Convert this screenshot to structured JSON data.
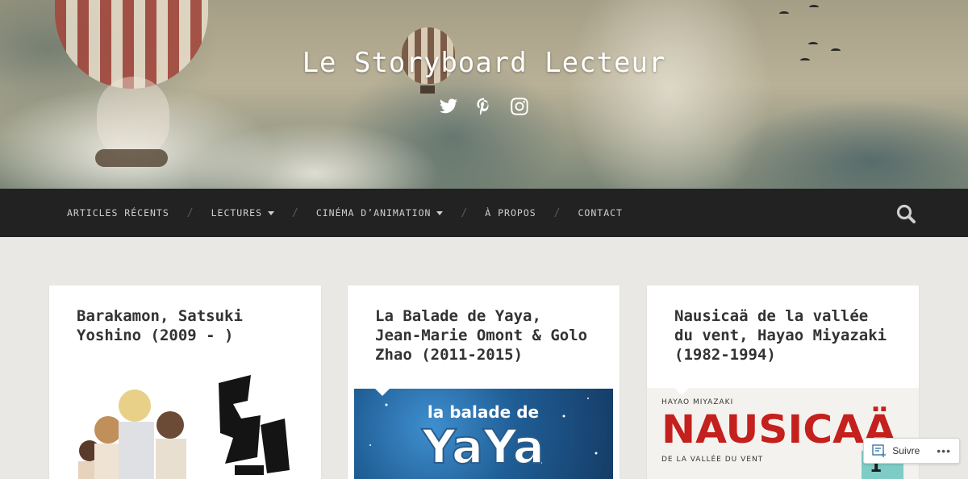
{
  "site": {
    "title": "Le Storyboard Lecteur"
  },
  "social": [
    {
      "name": "twitter",
      "icon": "twitter-icon"
    },
    {
      "name": "pinterest",
      "icon": "pinterest-icon"
    },
    {
      "name": "instagram",
      "icon": "instagram-icon"
    }
  ],
  "nav": {
    "items": [
      {
        "label": "ARTICLES RÉCENTS",
        "has_dropdown": false
      },
      {
        "label": "LECTURES",
        "has_dropdown": true
      },
      {
        "label": "CINÉMA D’ANIMATION",
        "has_dropdown": true
      },
      {
        "label": "À PROPOS",
        "has_dropdown": false
      },
      {
        "label": "CONTACT",
        "has_dropdown": false
      }
    ],
    "separator": "/",
    "search_icon": "search-icon"
  },
  "posts": [
    {
      "title": "Barakamon, Satsuki Yoshino (2009 - )",
      "cover_text": "BA"
    },
    {
      "title": "La Balade de Yaya, Jean-Marie Omont & Golo Zhao (2011-2015)",
      "cover_text": {
        "top": "la balade de",
        "big": "YaYa"
      }
    },
    {
      "title": "Nausicaä de la vallée du vent, Hayao Miyazaki (1982-1994)",
      "cover_text": {
        "author": "HAYAO MIYAZAKI",
        "big": "NAUSICAÄ",
        "sub": "DE LA VALLÉE DU VENT",
        "volume": "1"
      }
    }
  ],
  "follow": {
    "label": "Suivre",
    "more": "•••"
  },
  "colors": {
    "nav_bg": "#222222",
    "page_bg": "#e9e8e4",
    "card_bg": "#ffffff",
    "title_text": "#333333",
    "nausicaa_red": "#c4201d"
  }
}
